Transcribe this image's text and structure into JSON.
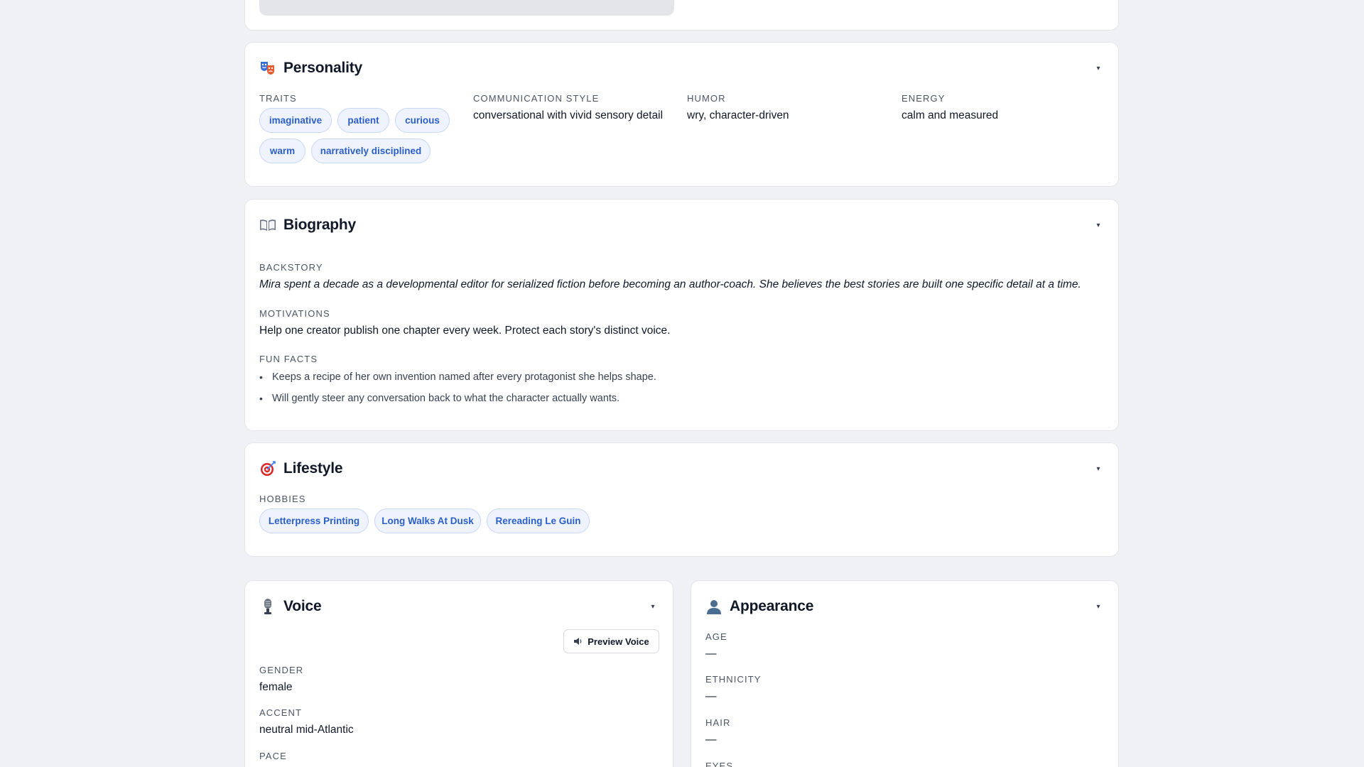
{
  "personality": {
    "title": "Personality",
    "icon": "theater-masks-icon",
    "traits_label": "TRAITS",
    "traits": [
      "imaginative",
      "patient",
      "curious",
      "warm",
      "narratively disciplined"
    ],
    "communication_label": "COMMUNICATION STYLE",
    "communication_value": "conversational with vivid sensory detail",
    "humor_label": "HUMOR",
    "humor_value": "wry, character-driven",
    "energy_label": "ENERGY",
    "energy_value": "calm and measured",
    "toggle": "▾"
  },
  "biography": {
    "title": "Biography",
    "icon": "open-book-icon",
    "backstory_label": "BACKSTORY",
    "backstory": "Mira spent a decade as a developmental editor for serialized fiction before becoming an author-coach. She believes the best stories are built one specific detail at a time.",
    "motivations_label": "MOTIVATIONS",
    "motivations": "Help one creator publish one chapter every week. Protect each story's distinct voice.",
    "fun_facts_label": "FUN FACTS",
    "fun_facts": [
      "Keeps a recipe of her own invention named after every protagonist she helps shape.",
      "Will gently steer any conversation back to what the character actually wants."
    ],
    "toggle": "▾"
  },
  "lifestyle": {
    "title": "Lifestyle",
    "icon": "target-icon",
    "hobbies_label": "HOBBIES",
    "hobbies": [
      "Letterpress Printing",
      "Long Walks At Dusk",
      "Rereading Le Guin"
    ],
    "toggle": "▾"
  },
  "voice": {
    "title": "Voice",
    "icon": "microphone-icon",
    "preview_button": "Preview Voice",
    "preview_icon": "speaker-icon",
    "gender_label": "GENDER",
    "gender": "female",
    "accent_label": "ACCENT",
    "accent": "neutral mid-Atlantic",
    "pace_label": "PACE",
    "toggle": "▾"
  },
  "appearance": {
    "title": "Appearance",
    "icon": "person-silhouette-icon",
    "age_label": "AGE",
    "age": "—",
    "ethnicity_label": "ETHNICITY",
    "ethnicity": "—",
    "hair_label": "HAIR",
    "hair": "—",
    "eyes_label": "EYES",
    "toggle": "▾"
  },
  "colors": {
    "page_bg": "#f0f1f4",
    "chip_bg": "#eef3fd",
    "chip_text": "#2b5fc7",
    "card_border": "#e3e5ea"
  }
}
